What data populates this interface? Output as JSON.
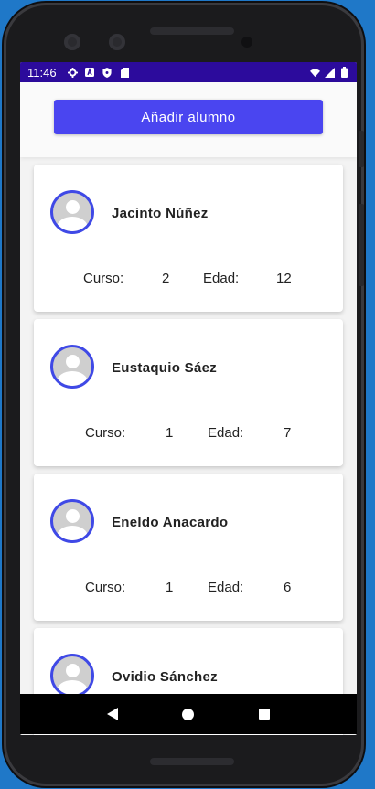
{
  "status": {
    "time": "11:46"
  },
  "toolbar": {
    "add_label": "Añadir alumno"
  },
  "labels": {
    "curso": "Curso:",
    "edad": "Edad:"
  },
  "students": [
    {
      "name": "Jacinto Núñez",
      "curso": "2",
      "edad": "12"
    },
    {
      "name": "Eustaquio Sáez",
      "curso": "1",
      "edad": "7"
    },
    {
      "name": "Eneldo Anacardo",
      "curso": "1",
      "edad": "6"
    },
    {
      "name": "Ovidio Sánchez",
      "curso": "",
      "edad": ""
    }
  ],
  "colors": {
    "accent": "#4a45f0",
    "status_bar": "#2c0b9c",
    "avatar_ring": "#3f49e6"
  },
  "icons": [
    "settings-icon",
    "a-badge-icon",
    "shield-icon",
    "sd-card-icon",
    "wifi-icon",
    "signal-icon",
    "battery-icon",
    "back-icon",
    "home-icon",
    "recents-icon"
  ]
}
